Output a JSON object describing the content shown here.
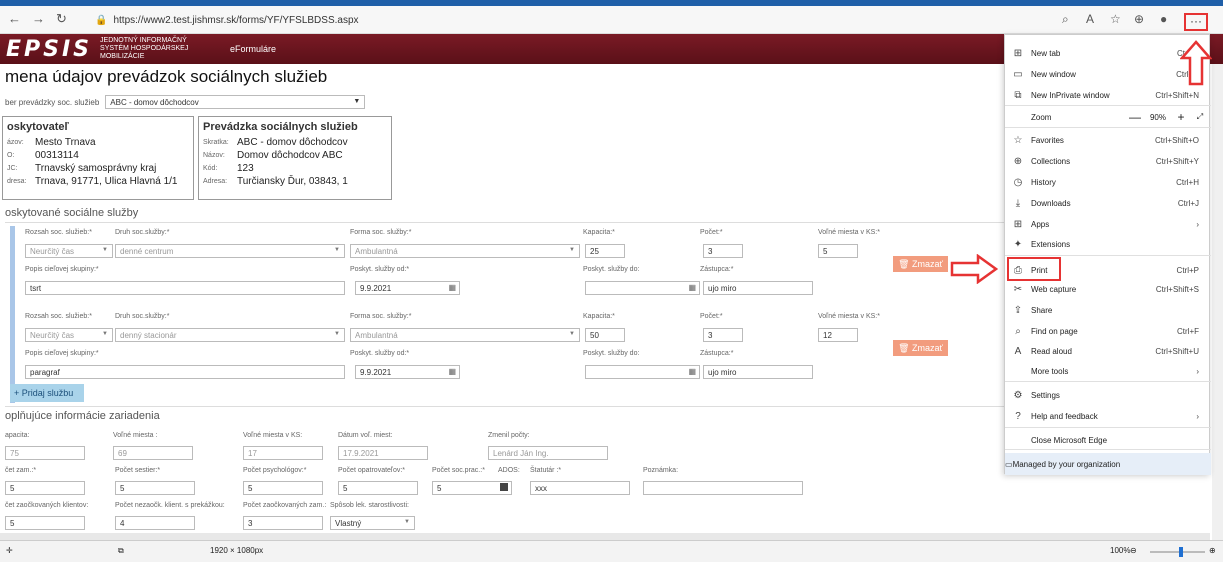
{
  "browser": {
    "url": "https://www2.test.jishmsr.sk/forms/YF/YFSLBDSS.aspx",
    "more_label": "···"
  },
  "site": {
    "logo": "EPSIS",
    "logo_sub": "JEDNOTNÝ INFORMAČNÝ SYSTÉM HOSPODÁRSKEJ MOBILIZÁCIE",
    "section": "eFormuláre"
  },
  "page": {
    "title": "mena údajov prevádzok sociálnych služieb",
    "select_label": "ber prevádzky soc. služieb",
    "select_value": "ABC - domov dôchodcov"
  },
  "provider": {
    "heading": "oskytovateľ",
    "rows": [
      {
        "k": "ázov:",
        "v": "Mesto Trnava"
      },
      {
        "k": "O:",
        "v": "00313114"
      },
      {
        "k": "JC:",
        "v": "Trnavský samosprávny kraj"
      },
      {
        "k": "dresa:",
        "v": "Trnava, 91771, Ulica Hlavná 1/1"
      }
    ]
  },
  "operation": {
    "heading": "Prevádzka sociálnych služieb",
    "rows": [
      {
        "k": "Skratka:",
        "v": "ABC - domov dôchodcov"
      },
      {
        "k": "Názov:",
        "v": "Domov dôchodcov ABC"
      },
      {
        "k": "Kód:",
        "v": "123"
      },
      {
        "k": "Adresa:",
        "v": "Turčiansky Ďur, 03843, 1"
      }
    ]
  },
  "services": {
    "title": "oskytované sociálne služby",
    "labels": {
      "rozsah": "Rozsah soc. služieb:*",
      "druh": "Druh soc.služby:*",
      "forma": "Forma soc. služby:*",
      "kapacita": "Kapacita:*",
      "pocet": "Počet:*",
      "volne": "Voľné miesta v KS:*",
      "popis": "Popis cieľovej skupiny:*",
      "od": "Poskyt. služby od:*",
      "do": "Poskyt. služby do:",
      "zastupca": "Zástupca:*"
    },
    "items": [
      {
        "rozsah": "Neurčitý čas",
        "druh": "denné centrum",
        "forma": "Ambulantná",
        "kapacita": "25",
        "pocet": "3",
        "volne": "5",
        "popis": "tsrt",
        "od": "9.9.2021",
        "do": "",
        "zastupca": "ujo miro"
      },
      {
        "rozsah": "Neurčitý čas",
        "druh": "denný stacionár",
        "forma": "Ambulantná",
        "kapacita": "50",
        "pocet": "3",
        "volne": "12",
        "popis": "paragraf",
        "od": "9.9.2021",
        "do": "",
        "zastupca": "ujo miro"
      }
    ],
    "delete_label": "🗑 Zmazať",
    "add_label": "+ Pridaj službu"
  },
  "extra": {
    "title": "oplňujúce informácie zariadenia",
    "labels": [
      "apacita:",
      "Voľné miesta :",
      "Voľné miesta v KS:",
      "Dátum voľ. miest:",
      "Zmenil počty:"
    ],
    "values": [
      "75",
      "69",
      "17",
      "17.9.2021",
      "Lenárd Ján Ing."
    ],
    "labels2": [
      "čet zam.:*",
      "Počet sestier:*",
      "Počet psychológov:*",
      "Počet opatrovateľov:*",
      "Počet soc.prac.:*",
      "ADOS:",
      "Štatutár :*",
      "Poznámka:"
    ],
    "values2": [
      "5",
      "5",
      "5",
      "5",
      "5",
      "",
      "xxx",
      ""
    ],
    "labels3": [
      "čet zaočkovaných klientov:",
      "Počet nezaočk. klient. s prekážkou:",
      "Počet zaočkovaných zam.:",
      "Spôsob lek. starostlivosti:"
    ],
    "values3": [
      "5",
      "4",
      "3",
      "Vlastný"
    ]
  },
  "menu": {
    "items": [
      {
        "icon": "new-tab-icon",
        "glyph": "⊞",
        "label": "New tab",
        "shortcut": "Ctrl+T"
      },
      {
        "icon": "new-window-icon",
        "glyph": "▭",
        "label": "New window",
        "shortcut": "Ctrl+N"
      },
      {
        "icon": "inprivate-icon",
        "glyph": "⧉",
        "label": "New InPrivate window",
        "shortcut": "Ctrl+Shift+N"
      },
      {
        "icon": "favorites-icon",
        "glyph": "☆",
        "label": "Favorites",
        "shortcut": "Ctrl+Shift+O"
      },
      {
        "icon": "collections-icon",
        "glyph": "⊕",
        "label": "Collections",
        "shortcut": "Ctrl+Shift+Y"
      },
      {
        "icon": "history-icon",
        "glyph": "◷",
        "label": "History",
        "shortcut": "Ctrl+H"
      },
      {
        "icon": "downloads-icon",
        "glyph": "⤓",
        "label": "Downloads",
        "shortcut": "Ctrl+J"
      },
      {
        "icon": "apps-icon",
        "glyph": "⊞",
        "label": "Apps",
        "shortcut": "›"
      },
      {
        "icon": "extensions-icon",
        "glyph": "✦",
        "label": "Extensions",
        "shortcut": ""
      },
      {
        "icon": "print-icon",
        "glyph": "⎙",
        "label": "Print",
        "shortcut": "Ctrl+P"
      },
      {
        "icon": "web-capture-icon",
        "glyph": "✂",
        "label": "Web capture",
        "shortcut": "Ctrl+Shift+S"
      },
      {
        "icon": "share-icon",
        "glyph": "⇪",
        "label": "Share",
        "shortcut": ""
      },
      {
        "icon": "find-icon",
        "glyph": "⌕",
        "label": "Find on page",
        "shortcut": "Ctrl+F"
      },
      {
        "icon": "read-aloud-icon",
        "glyph": "A",
        "label": "Read aloud",
        "shortcut": "Ctrl+Shift+U"
      },
      {
        "icon": "more-tools-icon",
        "glyph": "",
        "label": "More tools",
        "shortcut": "›"
      },
      {
        "icon": "settings-icon",
        "glyph": "⚙",
        "label": "Settings",
        "shortcut": ""
      },
      {
        "icon": "help-icon",
        "glyph": "?",
        "label": "Help and feedback",
        "shortcut": "›"
      },
      {
        "icon": "",
        "glyph": "",
        "label": "Close Microsoft Edge",
        "shortcut": ""
      }
    ],
    "zoom_label": "Zoom",
    "zoom_value": "90%",
    "managed": "Managed by your organization"
  },
  "status": {
    "resolution": "1920 × 1080px",
    "zoom": "100%"
  }
}
